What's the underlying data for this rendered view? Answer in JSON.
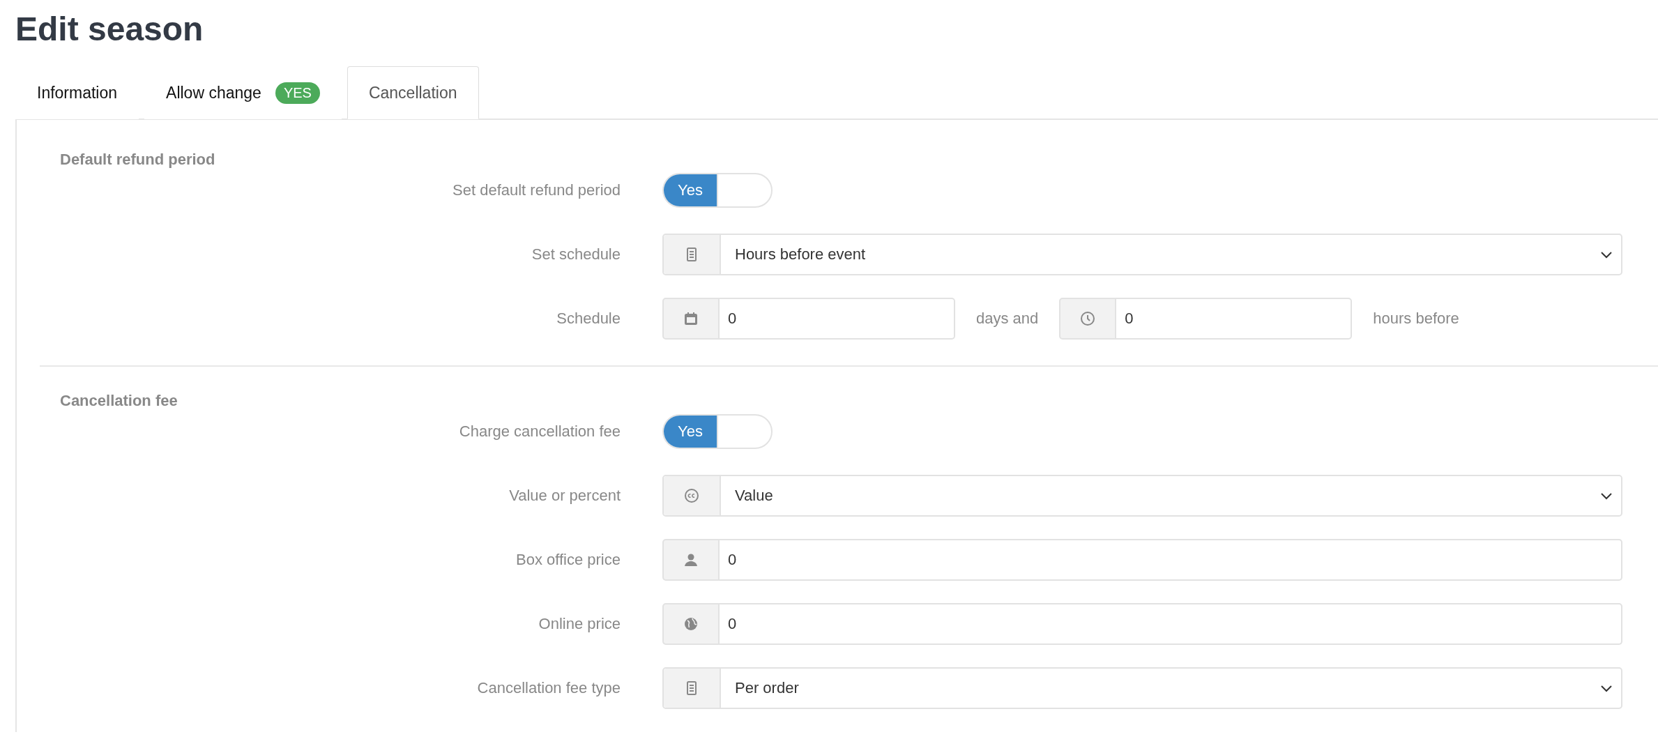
{
  "title": "Edit season",
  "tabs": [
    {
      "label": "Information",
      "selected": false
    },
    {
      "label": "Allow change",
      "badge": "YES",
      "selected": false
    },
    {
      "label": "Cancellation",
      "selected": true
    }
  ],
  "sections": [
    {
      "title": "Default refund period",
      "fields": [
        {
          "kind": "toggle",
          "label": "Set default refund period",
          "on": true,
          "toggle_label": "Yes"
        },
        {
          "kind": "select",
          "label": "Set schedule",
          "value": "Hours before event"
        },
        {
          "kind": "split",
          "label": "Schedule",
          "first_value": "0",
          "between": "days and",
          "second_value": "0",
          "after": "hours before"
        }
      ]
    },
    {
      "title": "Cancellation fee",
      "fields": [
        {
          "kind": "toggle",
          "label": "Charge cancellation fee",
          "on": true,
          "toggle_label": "Yes"
        },
        {
          "kind": "select",
          "label": "Value or percent",
          "value": "Value"
        },
        {
          "kind": "input",
          "label": "Box office price",
          "value": "0"
        },
        {
          "kind": "input",
          "label": "Online price",
          "value": "0"
        },
        {
          "kind": "select",
          "label": "Cancellation fee type",
          "value": "Per order"
        }
      ]
    }
  ]
}
